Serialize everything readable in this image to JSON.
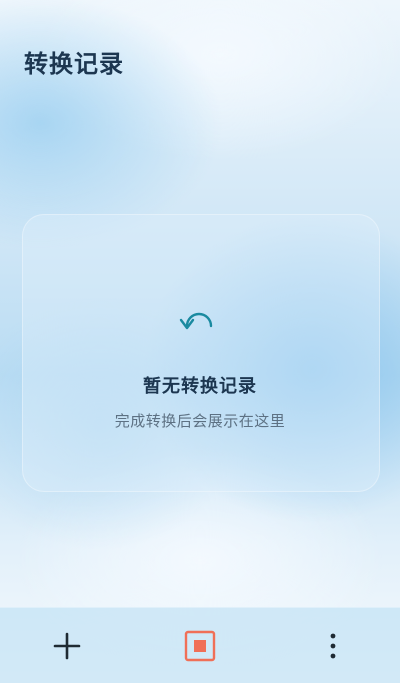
{
  "header": {
    "title": "转换记录"
  },
  "empty_state": {
    "icon": "refresh-icon",
    "title": "暂无转换记录",
    "subtitle": "完成转换后会展示在这里"
  },
  "bottom_bar": {
    "items": [
      {
        "icon": "plus-icon"
      },
      {
        "icon": "record-stop-icon",
        "color": "#f06f57"
      },
      {
        "icon": "more-vertical-icon"
      }
    ]
  },
  "colors": {
    "title": "#1c3650",
    "subtitle": "#5d7183",
    "icon_accent": "#1a8aa0",
    "record_accent": "#f06f57"
  }
}
